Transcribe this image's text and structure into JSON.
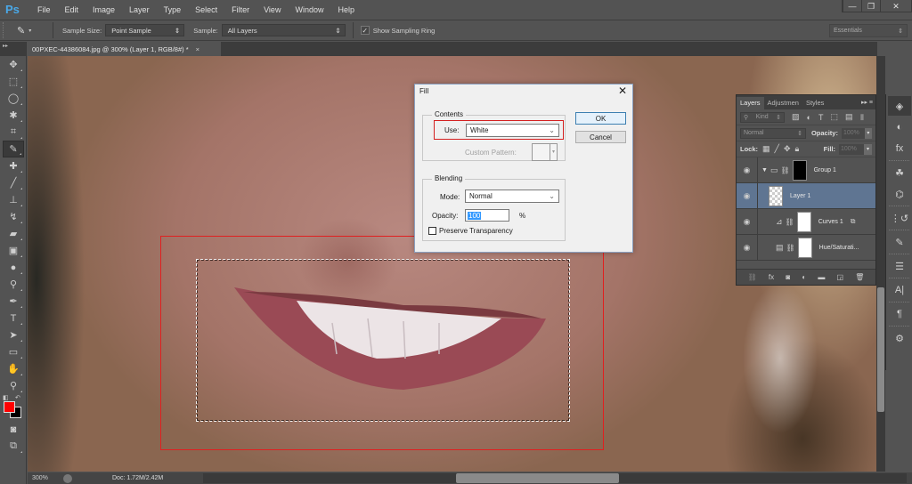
{
  "app": {
    "logo": "Ps"
  },
  "menu": [
    "File",
    "Edit",
    "Image",
    "Layer",
    "Type",
    "Select",
    "Filter",
    "View",
    "Window",
    "Help"
  ],
  "window_controls": {
    "minimize": "—",
    "restore": "❐",
    "close": "✕"
  },
  "options_bar": {
    "tool_icon": "eyedropper-icon",
    "sample_size_label": "Sample Size:",
    "sample_size_value": "Point Sample",
    "sample_label": "Sample:",
    "sample_value": "All Layers",
    "show_sampling_ring_label": "Show Sampling Ring",
    "show_sampling_ring_checked": true,
    "workspace": "Essentials"
  },
  "document_tab": {
    "title": "00PXEC-44386084.jpg @ 300% (Layer 1, RGB/8#) *",
    "close": "×"
  },
  "toolbox": {
    "tools": [
      "move",
      "marquee",
      "lasso",
      "magic-wand",
      "crop",
      "eyedropper",
      "spot-healing",
      "brush",
      "clone-stamp",
      "history-brush",
      "eraser",
      "gradient",
      "blur",
      "dodge",
      "pen",
      "type",
      "path-selection",
      "rectangle",
      "hand",
      "zoom"
    ],
    "active_tool": "eyedropper",
    "foreground_color": "#ff0000",
    "background_color": "#000000"
  },
  "fill_dialog": {
    "title": "Fill",
    "close": "✕",
    "contents_legend": "Contents",
    "use_label": "Use:",
    "use_value": "White",
    "custom_pattern_label": "Custom Pattern:",
    "blending_legend": "Blending",
    "mode_label": "Mode:",
    "mode_value": "Normal",
    "opacity_label": "Opacity:",
    "opacity_value": "100",
    "opacity_unit": "%",
    "preserve_transparency_label": "Preserve Transparency",
    "preserve_transparency_checked": false,
    "ok_label": "OK",
    "cancel_label": "Cancel"
  },
  "layers_panel": {
    "tabs": [
      "Layers",
      "Adjustmen",
      "Styles"
    ],
    "active_tab": "Layers",
    "filter_kind": "Kind",
    "blend_mode": "Normal",
    "opacity_label": "Opacity:",
    "opacity_value": "100%",
    "lock_label": "Lock:",
    "fill_label": "Fill:",
    "fill_value": "100%",
    "layers": [
      {
        "name": "Group 1",
        "type": "group",
        "visible": true,
        "selected": false
      },
      {
        "name": "Layer 1",
        "type": "pixel",
        "visible": true,
        "selected": true
      },
      {
        "name": "Curves 1",
        "type": "curves",
        "visible": true,
        "selected": false
      },
      {
        "name": "Hue/Saturati...",
        "type": "hue-saturation",
        "visible": true,
        "selected": false
      }
    ]
  },
  "right_dock": [
    "layers",
    "adjustments",
    "styles",
    "channels",
    "paths",
    "history",
    "brush-presets",
    "tool-presets",
    "character",
    "paragraph",
    "properties"
  ],
  "status_bar": {
    "zoom": "300%",
    "doc_info": "Doc: 1.72M/2.42M"
  },
  "annotations": {
    "highlight_color": "#e02020"
  }
}
